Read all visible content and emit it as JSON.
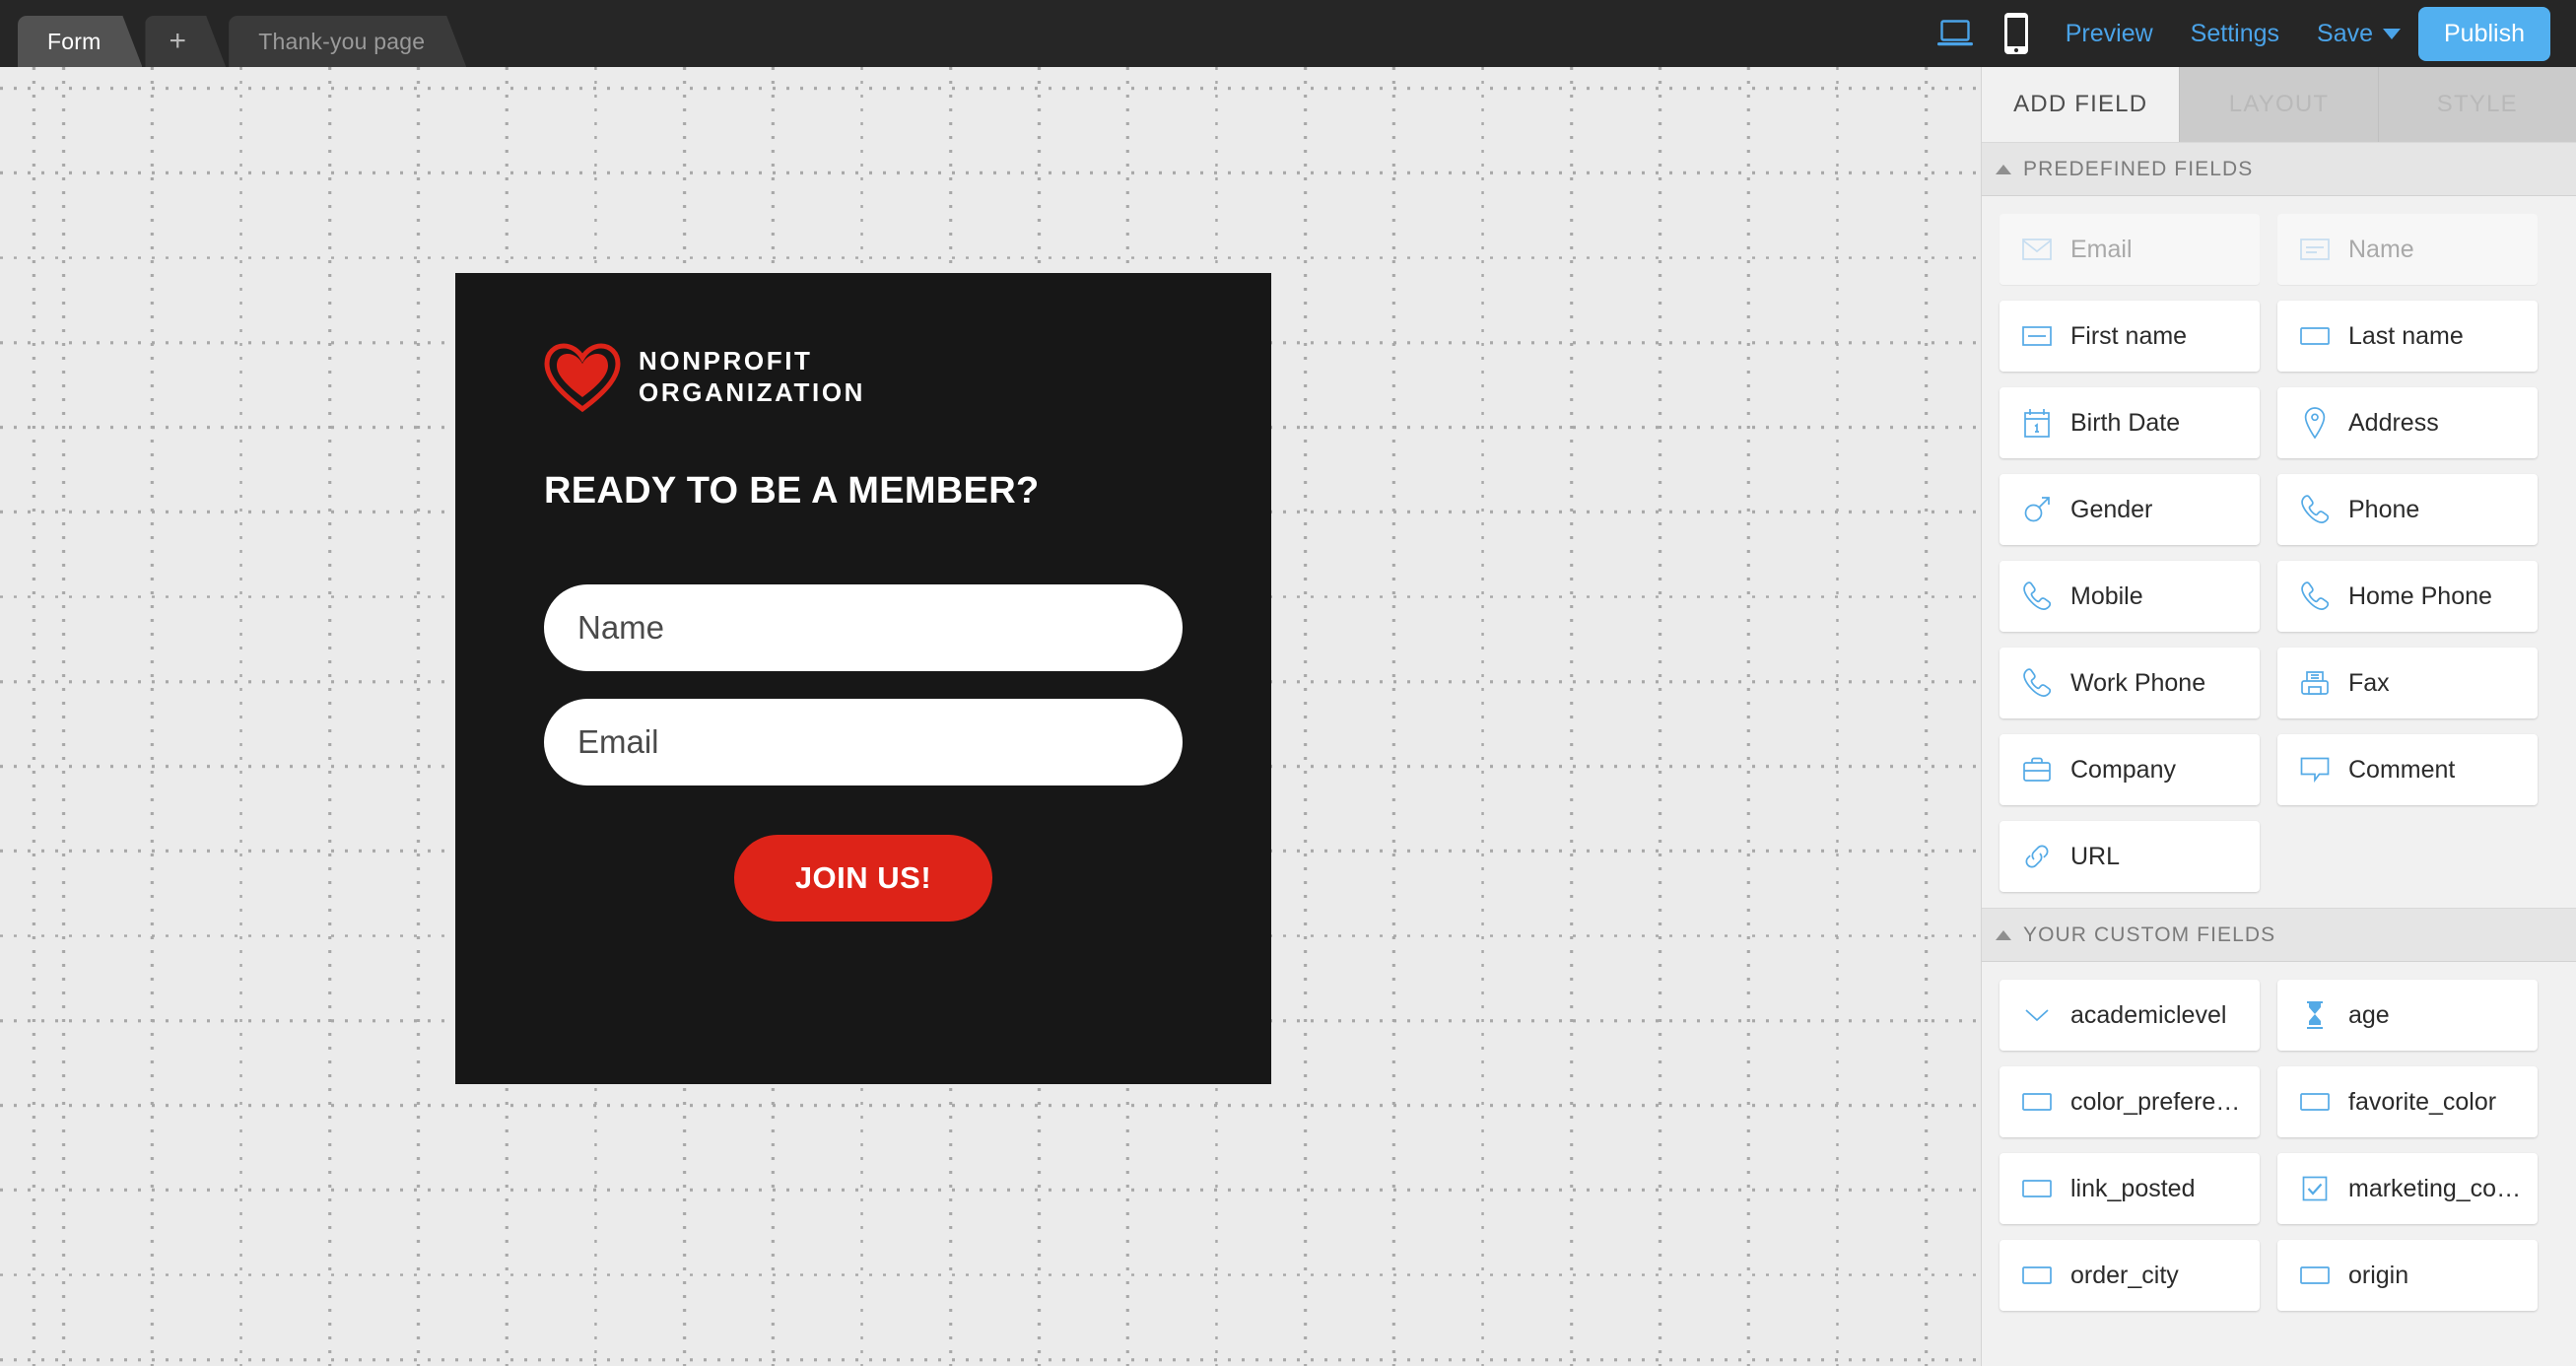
{
  "topbar": {
    "page_tabs": [
      {
        "label": "Form",
        "active": true
      },
      {
        "label": "+",
        "active": false,
        "kind": "add"
      },
      {
        "label": "Thank-you page",
        "active": false
      }
    ],
    "device_desktop_icon": "desktop-icon",
    "device_mobile_icon": "mobile-icon",
    "preview_label": "Preview",
    "settings_label": "Settings",
    "save_label": "Save",
    "publish_label": "Publish",
    "accent_link_color": "#4aa3e8",
    "publish_bg_color": "#52b0f0",
    "bar_bg_color": "#262626"
  },
  "form": {
    "card_bg_color": "#171717",
    "logo": {
      "icon": "heart-icon",
      "heart_color": "#dd2318",
      "line1": "NONPROFIT",
      "line2": "ORGANIZATION"
    },
    "headline": "READY TO BE A MEMBER?",
    "fields": [
      {
        "name": "name",
        "placeholder": "Name",
        "value": ""
      },
      {
        "name": "email",
        "placeholder": "Email",
        "value": ""
      }
    ],
    "submit_label": "JOIN US!",
    "submit_color": "#dd2318"
  },
  "panel": {
    "tabs": [
      {
        "label": "ADD FIELD",
        "active": true
      },
      {
        "label": "LAYOUT",
        "active": false
      },
      {
        "label": "STYLE",
        "active": false
      }
    ],
    "sections": [
      {
        "title": "PREDEFINED FIELDS",
        "collapsed": false,
        "fields": [
          {
            "label": "Email",
            "icon": "envelope-icon",
            "disabled": true
          },
          {
            "label": "Name",
            "icon": "textfield-lines-icon",
            "disabled": true
          },
          {
            "label": "First name",
            "icon": "textfield-line-icon",
            "disabled": false
          },
          {
            "label": "Last name",
            "icon": "textfield-icon",
            "disabled": false
          },
          {
            "label": "Birth Date",
            "icon": "calendar-icon",
            "disabled": false
          },
          {
            "label": "Address",
            "icon": "map-pin-icon",
            "disabled": false
          },
          {
            "label": "Gender",
            "icon": "gender-male-icon",
            "disabled": false
          },
          {
            "label": "Phone",
            "icon": "phone-icon",
            "disabled": false
          },
          {
            "label": "Mobile",
            "icon": "phone-icon",
            "disabled": false
          },
          {
            "label": "Home Phone",
            "icon": "phone-icon",
            "disabled": false
          },
          {
            "label": "Work Phone",
            "icon": "phone-icon",
            "disabled": false
          },
          {
            "label": "Fax",
            "icon": "fax-icon",
            "disabled": false
          },
          {
            "label": "Company",
            "icon": "briefcase-icon",
            "disabled": false
          },
          {
            "label": "Comment",
            "icon": "speech-bubble-icon",
            "disabled": false
          },
          {
            "label": "URL",
            "icon": "link-icon",
            "disabled": false
          }
        ]
      },
      {
        "title": "YOUR CUSTOM FIELDS",
        "collapsed": false,
        "fields": [
          {
            "label": "academiclevel",
            "icon": "chevron-down-icon",
            "disabled": false
          },
          {
            "label": "age",
            "icon": "hourglass-icon",
            "disabled": false
          },
          {
            "label": "color_prefere…",
            "icon": "textfield-icon",
            "disabled": false
          },
          {
            "label": "favorite_color",
            "icon": "textfield-icon",
            "disabled": false
          },
          {
            "label": "link_posted",
            "icon": "textfield-icon",
            "disabled": false
          },
          {
            "label": "marketing_co…",
            "icon": "checkbox-checked-icon",
            "disabled": false
          },
          {
            "label": "order_city",
            "icon": "textfield-icon",
            "disabled": false
          },
          {
            "label": "origin",
            "icon": "textfield-icon",
            "disabled": false
          }
        ]
      }
    ],
    "icon_color": "#54aae6"
  }
}
